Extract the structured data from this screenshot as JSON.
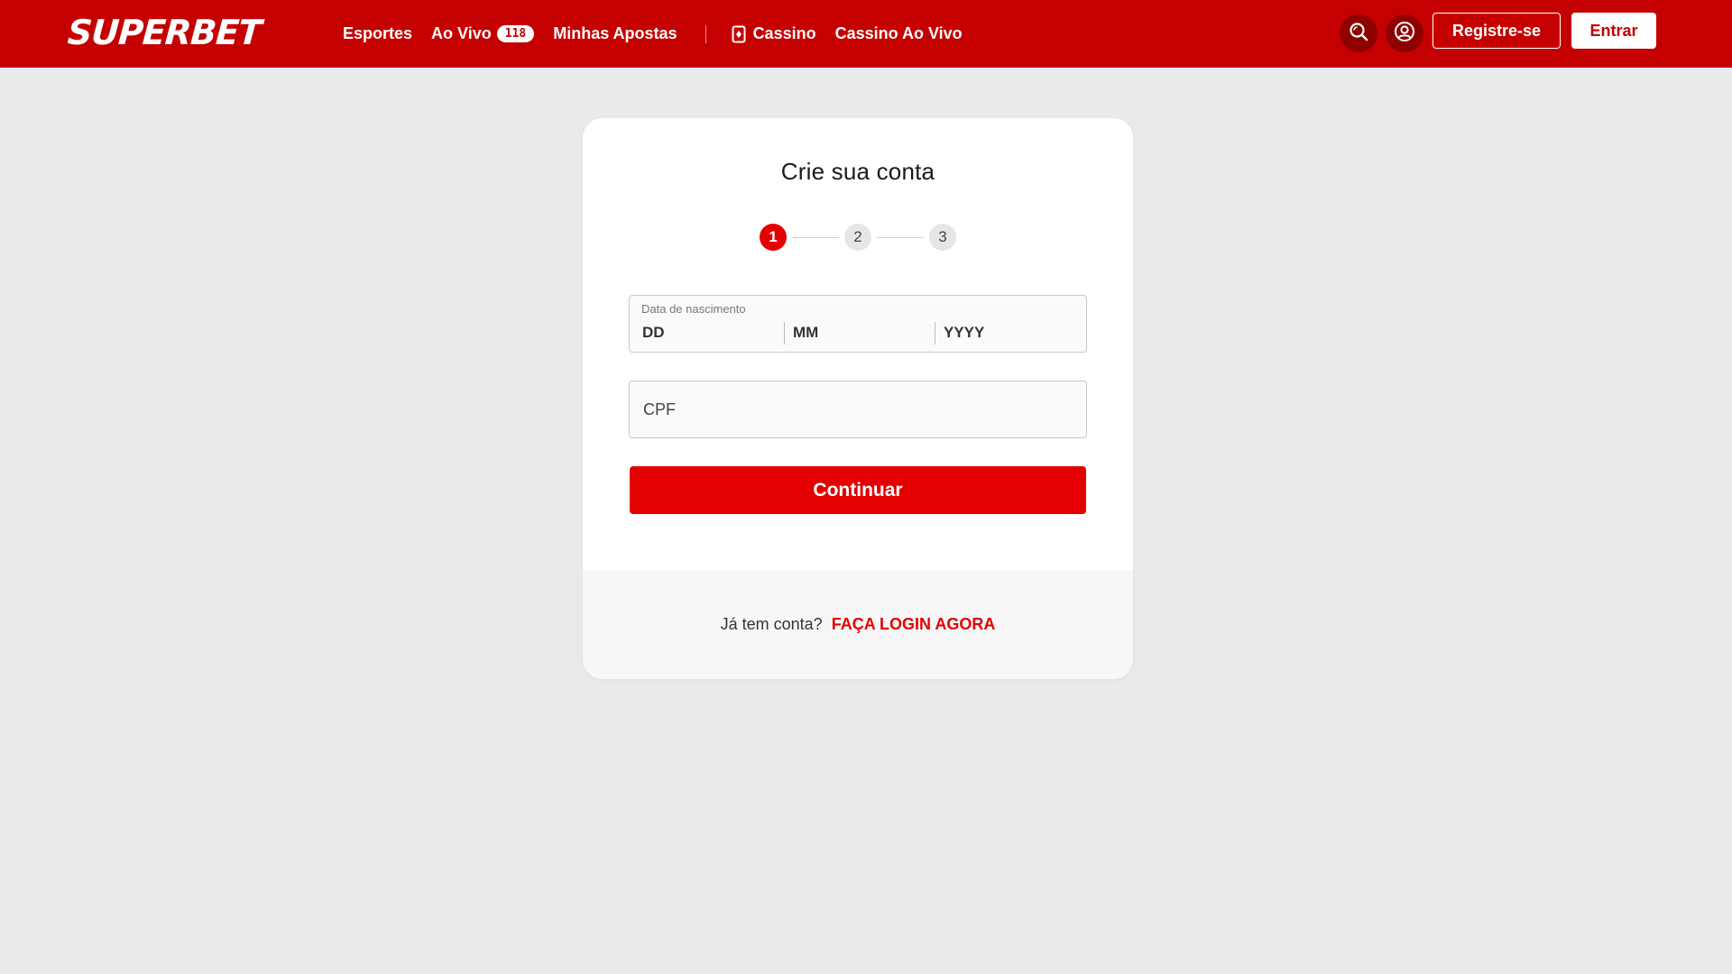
{
  "header": {
    "brand": "SUPERBET",
    "nav": {
      "esportes": "Esportes",
      "ao_vivo": "Ao Vivo",
      "ao_vivo_count": "118",
      "minhas_apostas": "Minhas Apostas",
      "cassino": "Cassino",
      "cassino_ao_vivo": "Cassino Ao Vivo"
    },
    "actions": {
      "search_icon": "search-icon",
      "account_icon": "user-icon",
      "register_label": "Registre-se",
      "login_label": "Entrar"
    }
  },
  "signup": {
    "title": "Crie sua conta",
    "steps": [
      "1",
      "2",
      "3"
    ],
    "current_step": 1,
    "dob": {
      "label": "Data de nascimento",
      "day_placeholder": "DD",
      "month_placeholder": "MM",
      "year_placeholder": "YYYY"
    },
    "cpf_placeholder": "CPF",
    "continue_label": "Continuar",
    "footer": {
      "question": "Já tem conta?",
      "login_link": "FAÇA LOGIN AGORA"
    }
  },
  "colors": {
    "brand_red": "#c50000",
    "accent_red": "#e30000",
    "background": "#e9eaec"
  }
}
